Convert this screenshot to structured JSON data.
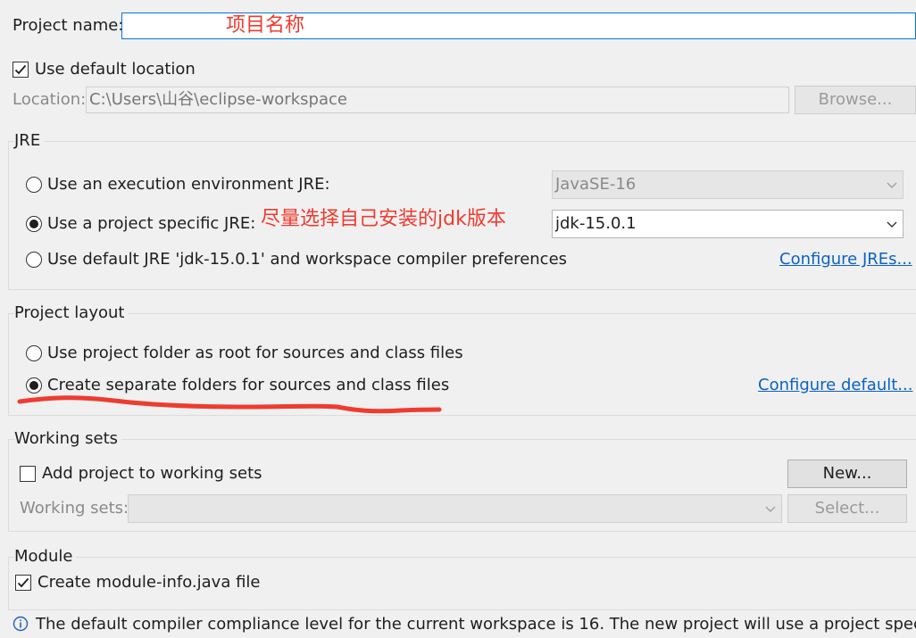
{
  "project": {
    "name_label": "Project name:",
    "name_value": "",
    "annotation": "项目名称"
  },
  "location": {
    "use_default_label": "Use default location",
    "use_default_checked": true,
    "location_label": "Location:",
    "location_value": "C:\\Users\\山谷\\eclipse-workspace",
    "browse_label": "Browse..."
  },
  "jre": {
    "title": "JRE",
    "option_env_label": "Use an execution environment JRE:",
    "env_value": "JavaSE-16",
    "option_specific_label": "Use a project specific JRE:",
    "specific_value": "jdk-15.0.1",
    "annotation": "尽量选择自己安装的jdk版本",
    "option_default_label": "Use default JRE 'jdk-15.0.1' and workspace compiler preferences",
    "configure_link": "Configure JREs...",
    "selected": "specific"
  },
  "layout": {
    "title": "Project layout",
    "option_root_label": "Use project folder as root for sources and class files",
    "option_separate_label": "Create separate folders for sources and class files",
    "configure_link": "Configure default...",
    "selected": "separate"
  },
  "working_sets": {
    "title": "Working sets",
    "add_label": "Add project to working sets",
    "add_checked": false,
    "new_button": "New...",
    "sets_label": "Working sets:",
    "select_button": "Select..."
  },
  "module": {
    "title": "Module",
    "create_label": "Create module-info.java file",
    "create_checked": true
  },
  "info": {
    "text": "The default compiler compliance level for the current workspace is 16. The new project will use a project specific..."
  },
  "colors": {
    "annotation": "#ef3b30",
    "link": "#0b62c2",
    "focus_border": "#0078d7"
  }
}
